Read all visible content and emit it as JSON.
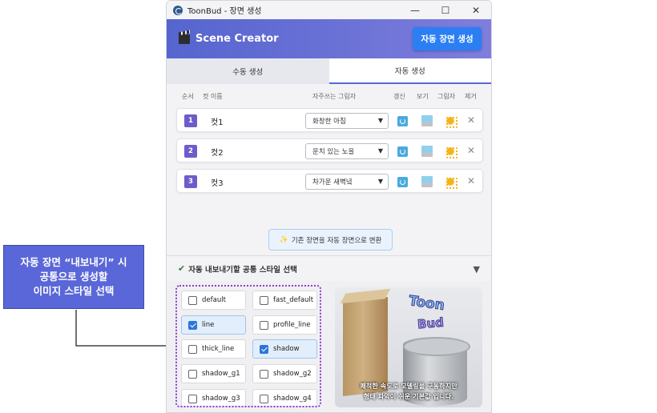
{
  "window": {
    "title": "ToonBud - 장면 생성",
    "controls": {
      "minimize": "—",
      "maximize": "☐",
      "close": "✕"
    }
  },
  "header": {
    "title": "Scene Creator",
    "action_button": "자동 장면 생성"
  },
  "tabs": [
    {
      "label": "수동 생성",
      "active": false
    },
    {
      "label": "자동 생성",
      "active": true
    }
  ],
  "table": {
    "columns": {
      "order": "순서",
      "cut_name": "컷 이름",
      "frequent_light": "자주쓰는 그림자",
      "refresh": "갱신",
      "view": "보기",
      "shadow": "그림자",
      "remove": "제거"
    },
    "rows": [
      {
        "num": "1",
        "name": "컷1",
        "preset": "화창한 아침"
      },
      {
        "num": "2",
        "name": "컷2",
        "preset": "운치 있는 노을"
      },
      {
        "num": "3",
        "name": "컷3",
        "preset": "차가운 새벽녘"
      }
    ]
  },
  "convert_button": {
    "icon": "✨",
    "label": "기존 장면을 자동 장면으로 변환"
  },
  "style_section": {
    "title": "자동 내보내기할 공통 스타일 선택",
    "options": [
      {
        "label": "default",
        "checked": false
      },
      {
        "label": "fast_default",
        "checked": false
      },
      {
        "label": "line",
        "checked": true
      },
      {
        "label": "profile_line",
        "checked": false
      },
      {
        "label": "thick_line",
        "checked": false
      },
      {
        "label": "shadow",
        "checked": true
      },
      {
        "label": "shadow_g1",
        "checked": false
      },
      {
        "label": "shadow_g2",
        "checked": false
      },
      {
        "label": "shadow_g3",
        "checked": false
      },
      {
        "label": "shadow_g4",
        "checked": false
      }
    ],
    "preview": {
      "logo_line1": "Toon",
      "logo_line2": "Bud",
      "caption_line1": "쾌적한 속도로 모델링을 구동하지만",
      "caption_line2": "형태 파악이 쉬운 기본값 입니다."
    }
  },
  "annotation": {
    "line1": "자동 장면 “내보내기” 시",
    "line2": "공통으로 생성할",
    "line3": "이미지 스타일 선택",
    "color": "#5a67d8"
  },
  "colors": {
    "accent": "#5a67d8",
    "primary_button": "#2c7ff3",
    "number_badge": "#6f5cc9",
    "style_box_border": "#8e3bd0"
  }
}
